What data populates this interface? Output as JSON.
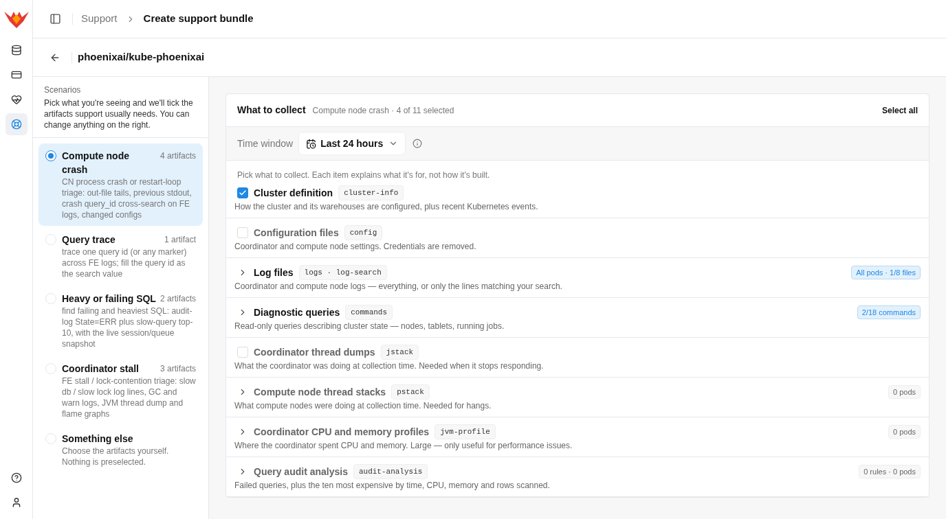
{
  "rail": {
    "items": [
      {
        "kind": "database",
        "selected": false
      },
      {
        "kind": "card",
        "selected": false
      },
      {
        "kind": "health",
        "selected": false
      },
      {
        "kind": "support",
        "selected": true
      }
    ],
    "bottom": [
      {
        "kind": "help"
      },
      {
        "kind": "user"
      }
    ]
  },
  "breadcrumb": [
    "Support",
    "Create support bundle"
  ],
  "header": {
    "title": "phoenixai/kube-phoenixai"
  },
  "scenarios": {
    "heading": "Scenarios",
    "intro": "Pick what you're seeing and we'll tick the artifacts support usually needs. You can change anything on the right.",
    "items": [
      {
        "title": "Compute node crash",
        "count": "4 artifacts",
        "description": "CN process crash or restart-loop triage: out-file tails, previous stdout, crash query_id cross-search on FE logs, changed configs",
        "selected": true
      },
      {
        "title": "Query trace",
        "count": "1 artifact",
        "description": "trace one query id (or any marker) across FE logs; fill the query id as the search value",
        "selected": false
      },
      {
        "title": "Heavy or failing SQL",
        "count": "2 artifacts",
        "description": "find failing and heaviest SQL: audit-log State=ERR plus slow-query top-10, with the live session/queue snapshot",
        "selected": false
      },
      {
        "title": "Coordinator stall",
        "count": "3 artifacts",
        "description": "FE stall / lock-contention triage: slow db / slow lock log lines, GC and warn logs, JVM thread dump and flame graphs",
        "selected": false
      },
      {
        "title": "Something else",
        "description": "Choose the artifacts yourself. Nothing is preselected.",
        "selected": false
      }
    ]
  },
  "collect": {
    "title": "What to collect",
    "summary": "Compute node crash · 4 of 11 selected",
    "select_all": "Select all",
    "time_window": {
      "label": "Time window",
      "value": "Last 24 hours"
    },
    "hint": "Pick what to collect. Each item explains what it's for, not how it's built.",
    "items": [
      {
        "kind": "checkbox",
        "title": "Cluster definition",
        "code": "cluster-info",
        "description": "How the cluster and its warehouses are configured, plus recent Kubernetes events.",
        "checked": true
      },
      {
        "kind": "checkbox",
        "title": "Configuration files",
        "code": "config",
        "description": "Coordinator and compute node settings. Credentials are removed.",
        "checked": false
      },
      {
        "kind": "expand",
        "title": "Log files",
        "code": "logs · log-search",
        "description": "Coordinator and compute node logs — everything, or only the lines matching your search.",
        "badge": "All pods · 1/8 files",
        "checked": true
      },
      {
        "kind": "expand",
        "title": "Diagnostic queries",
        "code": "commands",
        "description": "Read-only queries describing cluster state — nodes, tablets, running jobs.",
        "badge": "2/18 commands",
        "checked": true
      },
      {
        "kind": "checkbox",
        "title": "Coordinator thread dumps",
        "code": "jstack",
        "description": "What the coordinator was doing at collection time. Needed when it stops responding.",
        "checked": false
      },
      {
        "kind": "expand",
        "title": "Compute node thread stacks",
        "code": "pstack",
        "description": "What compute nodes were doing at collection time. Needed for hangs.",
        "badge": "0 pods",
        "checked": false
      },
      {
        "kind": "expand",
        "title": "Coordinator CPU and memory profiles",
        "code": "jvm-profile",
        "description": "Where the coordinator spent CPU and memory. Large — only useful for performance issues.",
        "badge": "0 pods",
        "checked": false
      },
      {
        "kind": "expand",
        "title": "Query audit analysis",
        "code": "audit-analysis",
        "description": "Failed queries, plus the ten most expensive by time, CPU, memory and rows scanned.",
        "badge": "0 rules · 0 pods",
        "checked": false
      }
    ]
  }
}
